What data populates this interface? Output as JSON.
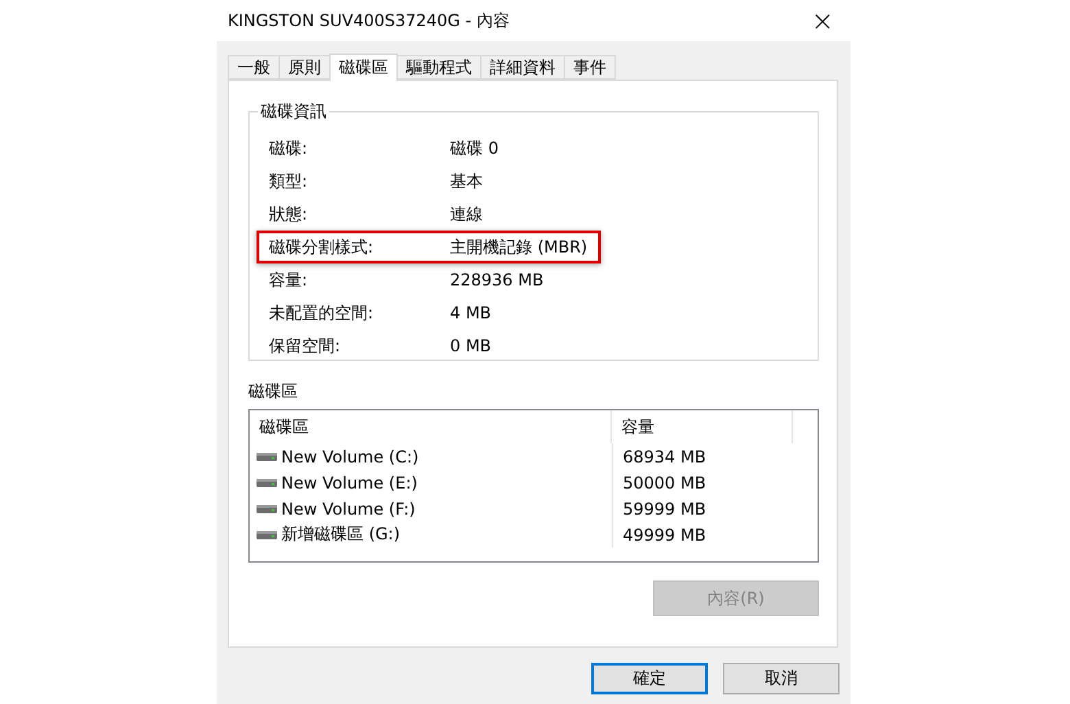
{
  "window": {
    "title": "KINGSTON SUV400S37240G - 內容",
    "close": "×"
  },
  "tabs": [
    {
      "label": "一般",
      "selected": false
    },
    {
      "label": "原則",
      "selected": false
    },
    {
      "label": "磁碟區",
      "selected": true
    },
    {
      "label": "驅動程式",
      "selected": false
    },
    {
      "label": "詳細資料",
      "selected": false
    },
    {
      "label": "事件",
      "selected": false
    }
  ],
  "disk_info": {
    "title": "磁碟資訊",
    "rows": [
      {
        "label": "磁碟:",
        "value": "磁碟 0",
        "highlighted": false
      },
      {
        "label": "類型:",
        "value": "基本",
        "highlighted": false
      },
      {
        "label": "狀態:",
        "value": "連線",
        "highlighted": false
      },
      {
        "label": "磁碟分割樣式:",
        "value": "主開機記錄 (MBR)",
        "highlighted": true
      },
      {
        "label": "容量:",
        "value": "228936 MB",
        "highlighted": false
      },
      {
        "label": "未配置的空間:",
        "value": "4 MB",
        "highlighted": false
      },
      {
        "label": "保留空間:",
        "value": "0 MB",
        "highlighted": false
      }
    ]
  },
  "volumes": {
    "title": "磁碟區",
    "columns": [
      "磁碟區",
      "容量"
    ],
    "rows": [
      {
        "name": "New Volume (C:)",
        "capacity": "68934 MB"
      },
      {
        "name": "New Volume (E:)",
        "capacity": "50000 MB"
      },
      {
        "name": "New Volume (F:)",
        "capacity": "59999 MB"
      },
      {
        "name": "新增磁碟區 (G:)",
        "capacity": "49999 MB"
      }
    ],
    "properties_button": {
      "label": "內容(R)",
      "disabled": true
    }
  },
  "buttons": [
    {
      "label": "確定",
      "default": true
    },
    {
      "label": "取消",
      "default": false
    }
  ]
}
